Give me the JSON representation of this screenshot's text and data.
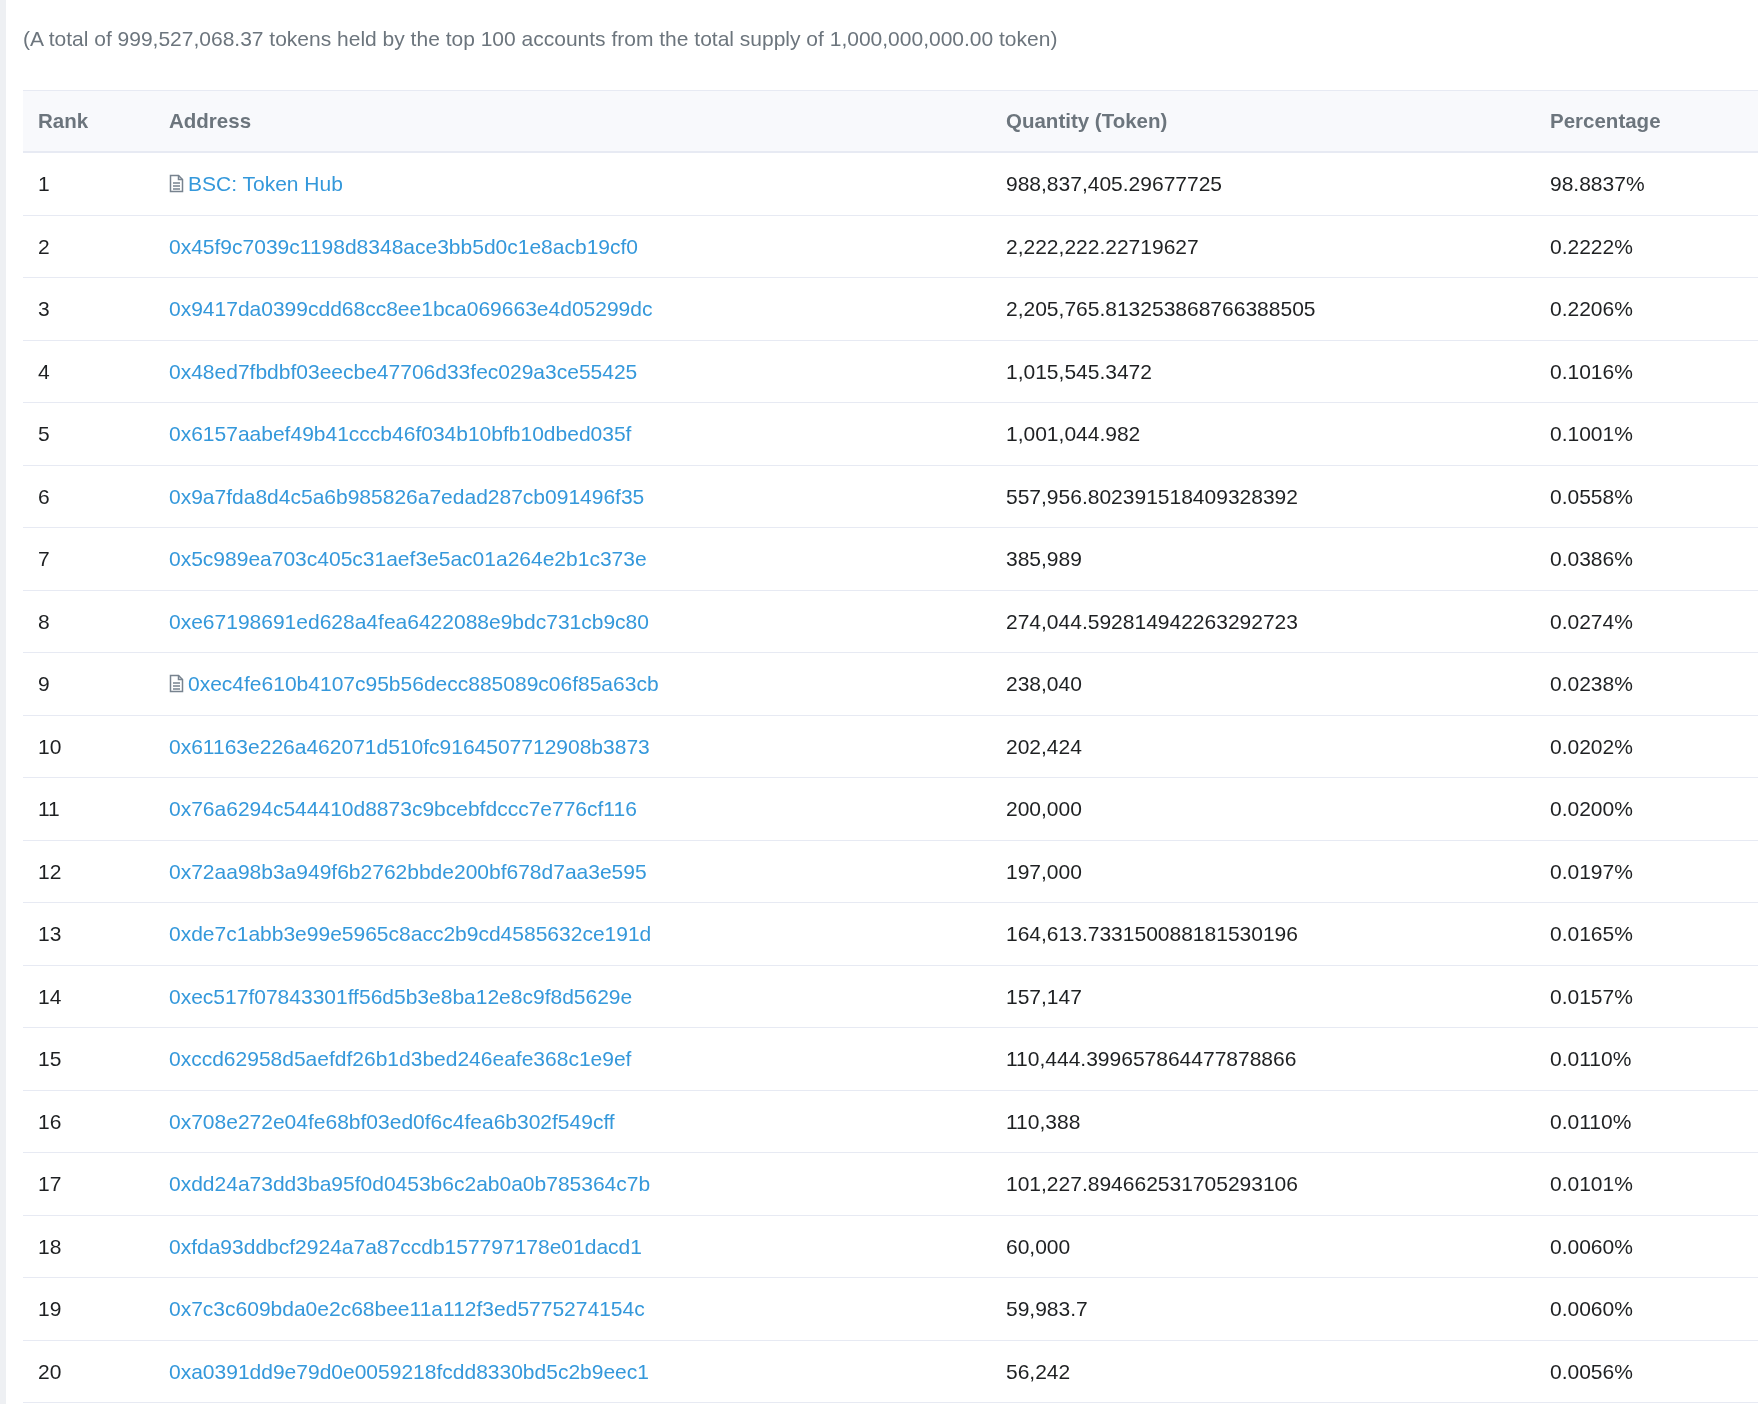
{
  "summary": "(A total of 999,527,068.37 tokens held by the top 100 accounts from the total supply of 1,000,000,000.00 token)",
  "table": {
    "columns": [
      "Rank",
      "Address",
      "Quantity (Token)",
      "Percentage"
    ],
    "rows": [
      {
        "rank": "1",
        "address": "BSC: Token Hub",
        "contract": true,
        "quantity": "988,837,405.29677725",
        "percentage": "98.8837%"
      },
      {
        "rank": "2",
        "address": "0x45f9c7039c1198d8348ace3bb5d0c1e8acb19cf0",
        "contract": false,
        "quantity": "2,222,222.22719627",
        "percentage": "0.2222%"
      },
      {
        "rank": "3",
        "address": "0x9417da0399cdd68cc8ee1bca069663e4d05299dc",
        "contract": false,
        "quantity": "2,205,765.813253868766388505",
        "percentage": "0.2206%"
      },
      {
        "rank": "4",
        "address": "0x48ed7fbdbf03eecbe47706d33fec029a3ce55425",
        "contract": false,
        "quantity": "1,015,545.3472",
        "percentage": "0.1016%"
      },
      {
        "rank": "5",
        "address": "0x6157aabef49b41cccb46f034b10bfb10dbed035f",
        "contract": false,
        "quantity": "1,001,044.982",
        "percentage": "0.1001%"
      },
      {
        "rank": "6",
        "address": "0x9a7fda8d4c5a6b985826a7edad287cb091496f35",
        "contract": false,
        "quantity": "557,956.802391518409328392",
        "percentage": "0.0558%"
      },
      {
        "rank": "7",
        "address": "0x5c989ea703c405c31aef3e5ac01a264e2b1c373e",
        "contract": false,
        "quantity": "385,989",
        "percentage": "0.0386%"
      },
      {
        "rank": "8",
        "address": "0xe67198691ed628a4fea6422088e9bdc731cb9c80",
        "contract": false,
        "quantity": "274,044.592814942263292723",
        "percentage": "0.0274%"
      },
      {
        "rank": "9",
        "address": "0xec4fe610b4107c95b56decc885089c06f85a63cb",
        "contract": true,
        "quantity": "238,040",
        "percentage": "0.0238%"
      },
      {
        "rank": "10",
        "address": "0x61163e226a462071d510fc9164507712908b3873",
        "contract": false,
        "quantity": "202,424",
        "percentage": "0.0202%"
      },
      {
        "rank": "11",
        "address": "0x76a6294c544410d8873c9bcebfdccc7e776cf116",
        "contract": false,
        "quantity": "200,000",
        "percentage": "0.0200%"
      },
      {
        "rank": "12",
        "address": "0x72aa98b3a949f6b2762bbde200bf678d7aa3e595",
        "contract": false,
        "quantity": "197,000",
        "percentage": "0.0197%"
      },
      {
        "rank": "13",
        "address": "0xde7c1abb3e99e5965c8acc2b9cd4585632ce191d",
        "contract": false,
        "quantity": "164,613.733150088181530196",
        "percentage": "0.0165%"
      },
      {
        "rank": "14",
        "address": "0xec517f07843301ff56d5b3e8ba12e8c9f8d5629e",
        "contract": false,
        "quantity": "157,147",
        "percentage": "0.0157%"
      },
      {
        "rank": "15",
        "address": "0xccd62958d5aefdf26b1d3bed246eafe368c1e9ef",
        "contract": false,
        "quantity": "110,444.399657864477878866",
        "percentage": "0.0110%"
      },
      {
        "rank": "16",
        "address": "0x708e272e04fe68bf03ed0f6c4fea6b302f549cff",
        "contract": false,
        "quantity": "110,388",
        "percentage": "0.0110%"
      },
      {
        "rank": "17",
        "address": "0xdd24a73dd3ba95f0d0453b6c2ab0a0b785364c7b",
        "contract": false,
        "quantity": "101,227.894662531705293106",
        "percentage": "0.0101%"
      },
      {
        "rank": "18",
        "address": "0xfda93ddbcf2924a7a87ccdb157797178e01dacd1",
        "contract": false,
        "quantity": "60,000",
        "percentage": "0.0060%"
      },
      {
        "rank": "19",
        "address": "0x7c3c609bda0e2c68bee11a112f3ed5775274154c",
        "contract": false,
        "quantity": "59,983.7",
        "percentage": "0.0060%"
      },
      {
        "rank": "20",
        "address": "0xa0391dd9e79d0e0059218fcdd8330bd5c2b9eec1",
        "contract": false,
        "quantity": "56,242",
        "percentage": "0.0056%"
      }
    ]
  }
}
